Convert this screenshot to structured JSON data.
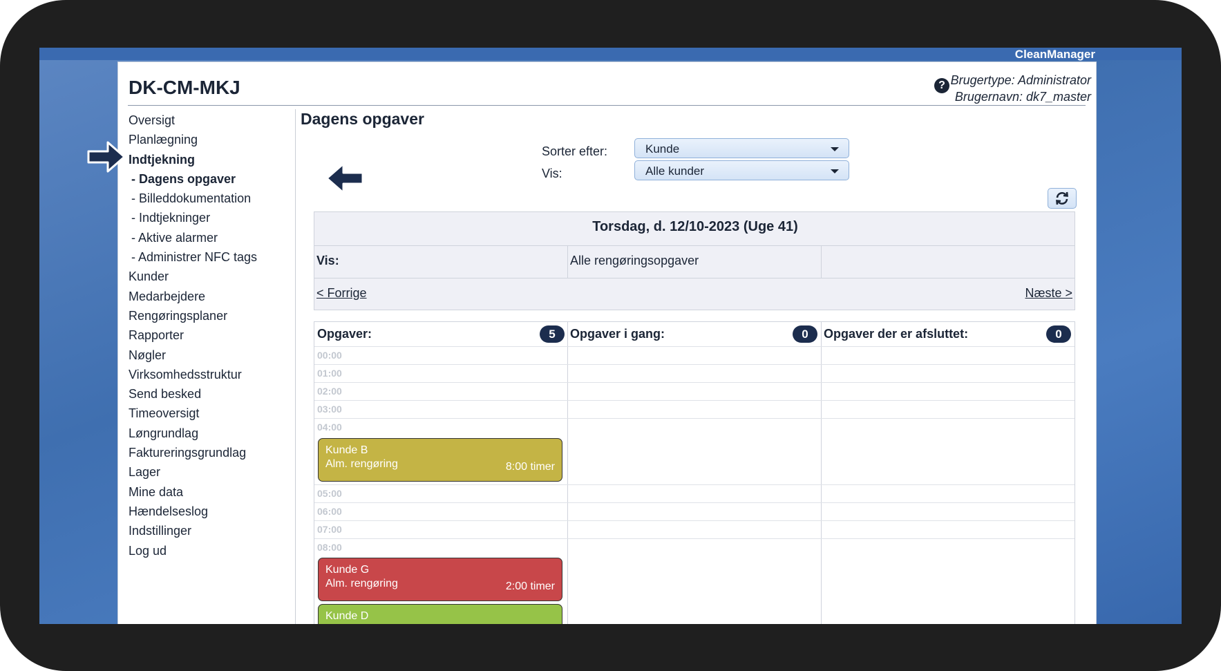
{
  "app": {
    "brand": "CleanManager",
    "site": "DK-CM-MKJ"
  },
  "user": {
    "type": "Brugertype: Administrator",
    "name": "Brugernavn: dk7_master"
  },
  "nav": {
    "items": [
      {
        "label": "Oversigt",
        "sub": false,
        "active": false
      },
      {
        "label": "Planlægning",
        "sub": false,
        "active": false
      },
      {
        "label": "Indtjekning",
        "sub": false,
        "active": true
      },
      {
        "label": "- Dagens opgaver",
        "sub": true,
        "active": true
      },
      {
        "label": "- Billeddokumentation",
        "sub": true,
        "active": false
      },
      {
        "label": "- Indtjekninger",
        "sub": true,
        "active": false
      },
      {
        "label": "- Aktive alarmer",
        "sub": true,
        "active": false
      },
      {
        "label": "- Administrer NFC tags",
        "sub": true,
        "active": false
      },
      {
        "label": "Kunder",
        "sub": false,
        "active": false
      },
      {
        "label": "Medarbejdere",
        "sub": false,
        "active": false
      },
      {
        "label": "Rengøringsplaner",
        "sub": false,
        "active": false
      },
      {
        "label": "Rapporter",
        "sub": false,
        "active": false
      },
      {
        "label": "Nøgler",
        "sub": false,
        "active": false
      },
      {
        "label": "Virksomhedsstruktur",
        "sub": false,
        "active": false
      },
      {
        "label": "Send besked",
        "sub": false,
        "active": false
      },
      {
        "label": "Timeoversigt",
        "sub": false,
        "active": false
      },
      {
        "label": "Løngrundlag",
        "sub": false,
        "active": false
      },
      {
        "label": "Faktureringsgrundlag",
        "sub": false,
        "active": false
      },
      {
        "label": "Lager",
        "sub": false,
        "active": false
      },
      {
        "label": "Mine data",
        "sub": false,
        "active": false
      },
      {
        "label": "Hændelseslog",
        "sub": false,
        "active": false
      },
      {
        "label": "Indstillinger",
        "sub": false,
        "active": false
      },
      {
        "label": "Log ud",
        "sub": false,
        "active": false
      }
    ]
  },
  "main": {
    "title": "Dagens opgaver",
    "sort_label": "Sorter efter:",
    "sort_value": "Kunde",
    "vis_label": "Vis:",
    "vis_value": "Alle kunder",
    "date_heading": "Torsdag, d. 12/10-2023 (Uge 41)",
    "filter_label": "Vis:",
    "filter_value": "Alle rengøringsopgaver",
    "prev": "< Forrige",
    "next": "Næste >"
  },
  "columns": [
    {
      "title": "Opgaver:",
      "count": "5"
    },
    {
      "title": "Opgaver i gang:",
      "count": "0"
    },
    {
      "title": "Opgaver der er afsluttet:",
      "count": "0"
    }
  ],
  "hours": [
    "00:00",
    "01:00",
    "02:00",
    "03:00",
    "04:00",
    "05:00",
    "06:00",
    "07:00",
    "08:00"
  ],
  "tasks": [
    {
      "name": "Kunde B",
      "type": "Alm. rengøring",
      "duration": "8:00 timer",
      "color": "#c4b445"
    },
    {
      "name": "Kunde G",
      "type": "Alm. rengøring",
      "duration": "2:00 timer",
      "color": "#c8474a"
    },
    {
      "name": "Kunde D",
      "type": "",
      "duration": "",
      "color": "#96c348"
    }
  ]
}
